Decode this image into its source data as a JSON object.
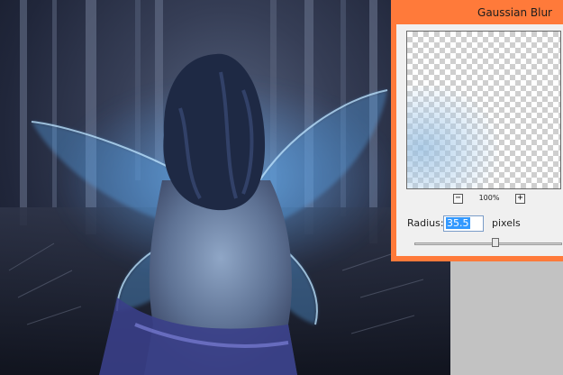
{
  "dialog": {
    "title": "Gaussian Blur",
    "zoom_level": "100%",
    "zoom_out_label": "−",
    "zoom_in_label": "+",
    "radius_label": "Radius:",
    "radius_value": "35.5",
    "units_label": "pixels",
    "radius_slider_fraction": 0.55,
    "title_bar_color": "#ff7a3a"
  },
  "canvas": {
    "subject": "fairy-with-glowing-wings-image"
  }
}
